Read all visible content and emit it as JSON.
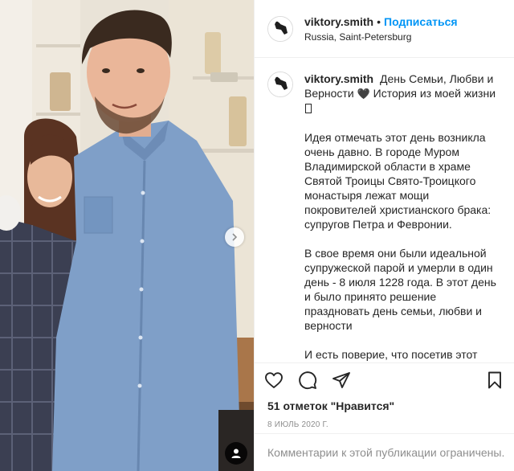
{
  "post": {
    "photo_alt": "",
    "icons": {
      "carousel_next": "chevron-right-icon",
      "tagged_users": "person-tag-icon"
    }
  },
  "header": {
    "username": "viktory.smith",
    "separator": "•",
    "follow_label": "Подписаться",
    "location": "Russia, Saint-Petersburg"
  },
  "caption": {
    "username": "viktory.smith",
    "first_line": "День Семьи, Любви и Верности",
    "first_line_end": "История из моей жизни",
    "heart_glyph": "🖤",
    "paragraphs": [
      "Идея отмечать этот день возникла очень давно. В городе Муром Владимирской области в храме Святой Троицы Свято-Троицкого монастыря лежат мощи покровителей христианского брака: супругов Петра и Февронии.",
      "В свое время они были идеальной супружеской парой и умерли в один день - 8 июля 1228 года. В этот день и было принято решение праздновать день семьи, любви и верности",
      "И есть поверие, что посетив этот храм, человек обретает семью."
    ]
  },
  "actions": {
    "like_icon": "heart-icon",
    "comment_icon": "comment-icon",
    "share_icon": "paper-plane-icon",
    "save_icon": "bookmark-icon"
  },
  "likes_text": "51 отметок \"Нравится\"",
  "date_text": "8 ИЮЛЬ 2020 Г.",
  "comments_restricted": "Комментарии к этой публикации ограничены.",
  "colors": {
    "link_blue": "#0095f6",
    "text": "#262626",
    "muted": "#8e8e8e",
    "border": "#efefef"
  }
}
